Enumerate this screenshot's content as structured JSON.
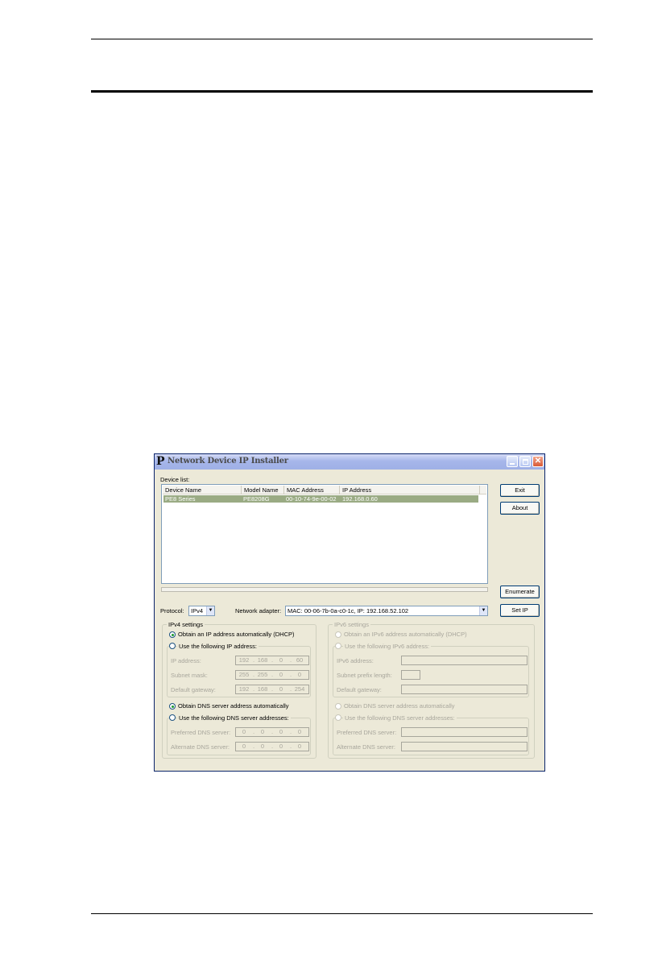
{
  "window": {
    "title": "Network Device IP Installer",
    "app_icon": "P",
    "close_glyph": "✕"
  },
  "device_list": {
    "label": "Device list:",
    "columns": [
      "Device Name",
      "Model Name",
      "MAC Address",
      "IP Address"
    ],
    "rows": [
      [
        "PE8 Series",
        "PE8208G",
        "00-10-74-9e-00-02",
        "192.168.0.60"
      ]
    ]
  },
  "buttons": {
    "exit": "Exit",
    "about": "About",
    "enumerate": "Enumerate",
    "set_ip": "Set IP"
  },
  "protocol": {
    "label": "Protocol:",
    "value": "IPv4"
  },
  "network_adapter": {
    "label": "Network adapter:",
    "value": "MAC: 00-06-7b-0a-c0-1c,  IP: 192.168.52.102"
  },
  "ipv4": {
    "group_title": "IPv4 settings",
    "obtain_ip_auto": "Obtain an IP address automatically (DHCP)",
    "use_following_ip": "Use the following IP address:",
    "ip_address_label": "IP address:",
    "ip_address": [
      "192",
      "168",
      "0",
      "60"
    ],
    "subnet_mask_label": "Subnet mask:",
    "subnet_mask": [
      "255",
      "255",
      "0",
      "0"
    ],
    "default_gateway_label": "Default gateway:",
    "default_gateway": [
      "192",
      "168",
      "0",
      "254"
    ],
    "obtain_dns_auto": "Obtain DNS server address automatically",
    "use_following_dns": "Use the following DNS server addresses:",
    "preferred_dns_label": "Preferred DNS server:",
    "preferred_dns": [
      "0",
      "0",
      "0",
      "0"
    ],
    "alternate_dns_label": "Alternate DNS server:",
    "alternate_dns": [
      "0",
      "0",
      "0",
      "0"
    ]
  },
  "ipv6": {
    "group_title": "IPv6 settings",
    "obtain_ip_auto": "Obtain an IPv6 address automatically (DHCP)",
    "use_following_ip": "Use the following IPv6 address:",
    "ip_address_label": "IPv6 address:",
    "prefix_label": "Subnet prefix length:",
    "gateway_label": "Default gateway:",
    "obtain_dns_auto": "Obtain DNS server address automatically",
    "use_following_dns": "Use the following DNS server addresses:",
    "preferred_dns_label": "Preferred DNS server:",
    "alternate_dns_label": "Alternate DNS server:"
  },
  "colors": {
    "selected_row": "#9aab84",
    "dialog_face": "#ece9d8",
    "titlebar": "#a6b6ea"
  }
}
